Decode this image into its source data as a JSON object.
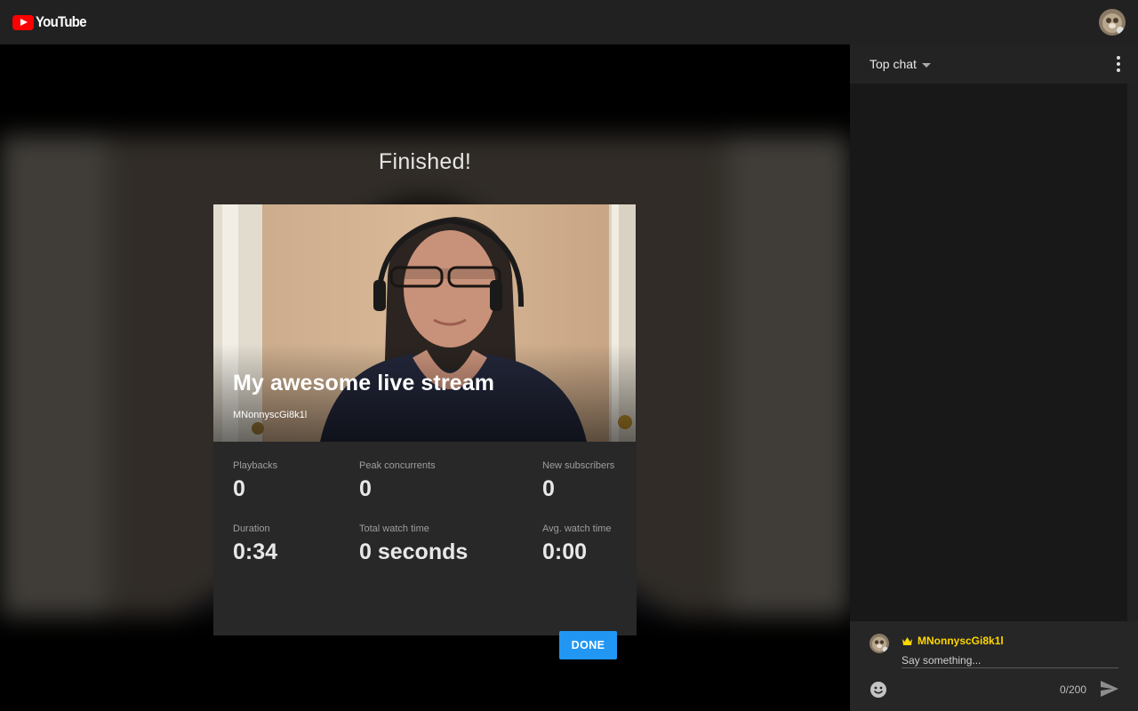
{
  "header": {
    "logo_text": "YouTube",
    "avatar_icon": "user-avatar-icon"
  },
  "summary": {
    "title": "Finished!",
    "stream_title": "My awesome live stream",
    "channel_name": "MNonnyscGi8k1l",
    "stats": {
      "playbacks": {
        "label": "Playbacks",
        "value": "0"
      },
      "peak_concurrents": {
        "label": "Peak concurrents",
        "value": "0"
      },
      "new_subscribers": {
        "label": "New subscribers",
        "value": "0"
      },
      "duration": {
        "label": "Duration",
        "value": "0:34"
      },
      "total_watch_time": {
        "label": "Total watch time",
        "value": "0 seconds"
      },
      "avg_watch_time": {
        "label": "Avg. watch time",
        "value": "0:00"
      }
    },
    "done_label": "DONE",
    "done_color": "#2196f3"
  },
  "chat": {
    "mode_label": "Top chat",
    "author_name": "MNonnyscGi8k1l",
    "author_color": "#ffd600",
    "input_placeholder": "Say something...",
    "input_value": "",
    "char_count": "0/200",
    "icons": [
      "crown-icon",
      "emoji-icon",
      "send-icon",
      "more-options-icon",
      "chevron-down-icon"
    ]
  }
}
